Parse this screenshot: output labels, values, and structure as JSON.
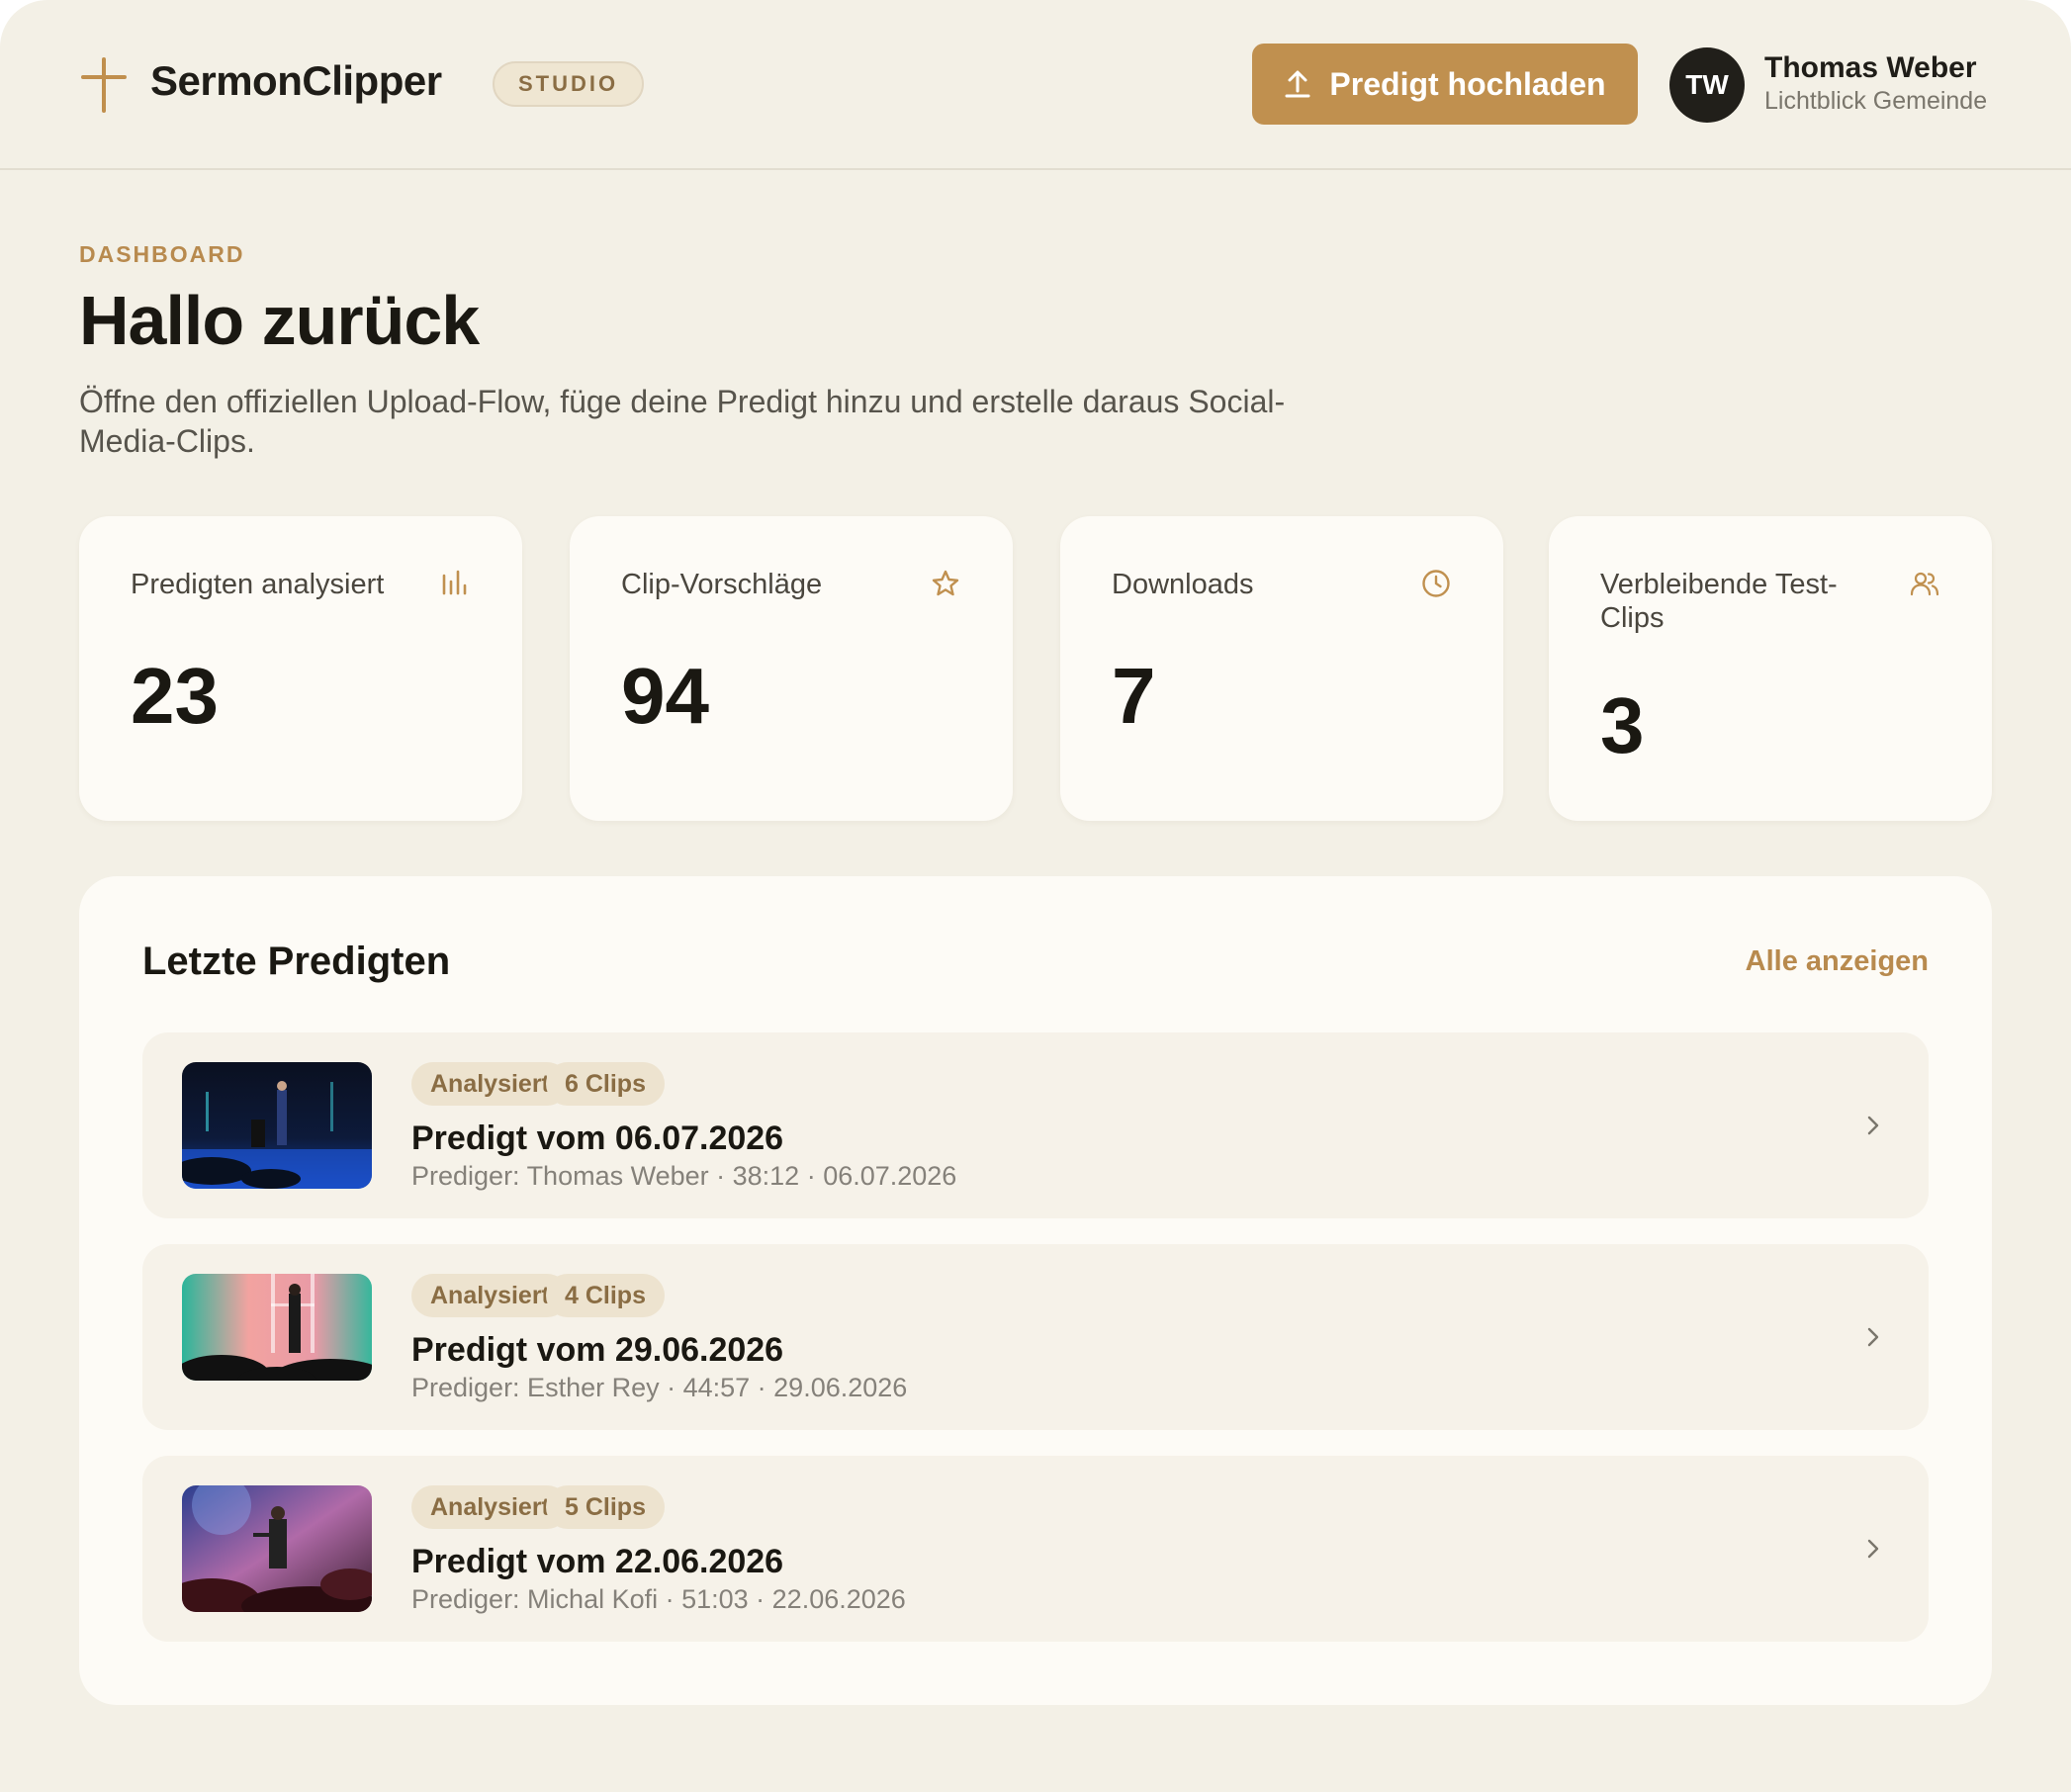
{
  "header": {
    "brand": "SermonClipper",
    "badge": "STUDIO",
    "upload_label": "Predigt hochladen",
    "user": {
      "initials": "TW",
      "name": "Thomas Weber",
      "org": "Lichtblick Gemeinde"
    }
  },
  "intro": {
    "eyebrow": "DASHBOARD",
    "title": "Hallo zurück",
    "subtitle": "Öffne den offiziellen Upload-Flow, füge deine Predigt hinzu und erstelle daraus Social-Media-Clips."
  },
  "stats": [
    {
      "label": "Predigten analysiert",
      "value": "23",
      "icon": "bar-chart-icon"
    },
    {
      "label": "Clip-Vorschläge",
      "value": "94",
      "icon": "star-icon"
    },
    {
      "label": "Downloads",
      "value": "7",
      "icon": "clock-icon"
    },
    {
      "label": "Verbleibende Test-Clips",
      "value": "3",
      "icon": "users-icon"
    }
  ],
  "recent": {
    "title": "Letzte Predigten",
    "view_all": "Alle anzeigen",
    "items": [
      {
        "status": "Analysiert",
        "clips": "6 Clips",
        "title": "Predigt vom 06.07.2026",
        "meta": "Prediger: Thomas Weber · 38:12 · 06.07.2026"
      },
      {
        "status": "Analysiert",
        "clips": "4 Clips",
        "title": "Predigt vom 29.06.2026",
        "meta": "Prediger: Esther Rey · 44:57 · 29.06.2026"
      },
      {
        "status": "Analysiert",
        "clips": "5 Clips",
        "title": "Predigt vom 22.06.2026",
        "meta": "Prediger: Michal Kofi · 51:03 · 22.06.2026"
      }
    ]
  },
  "colors": {
    "accent": "#c0904f",
    "background": "#f3f0e6",
    "card": "#fdfbf6",
    "dark": "#211f1a"
  }
}
